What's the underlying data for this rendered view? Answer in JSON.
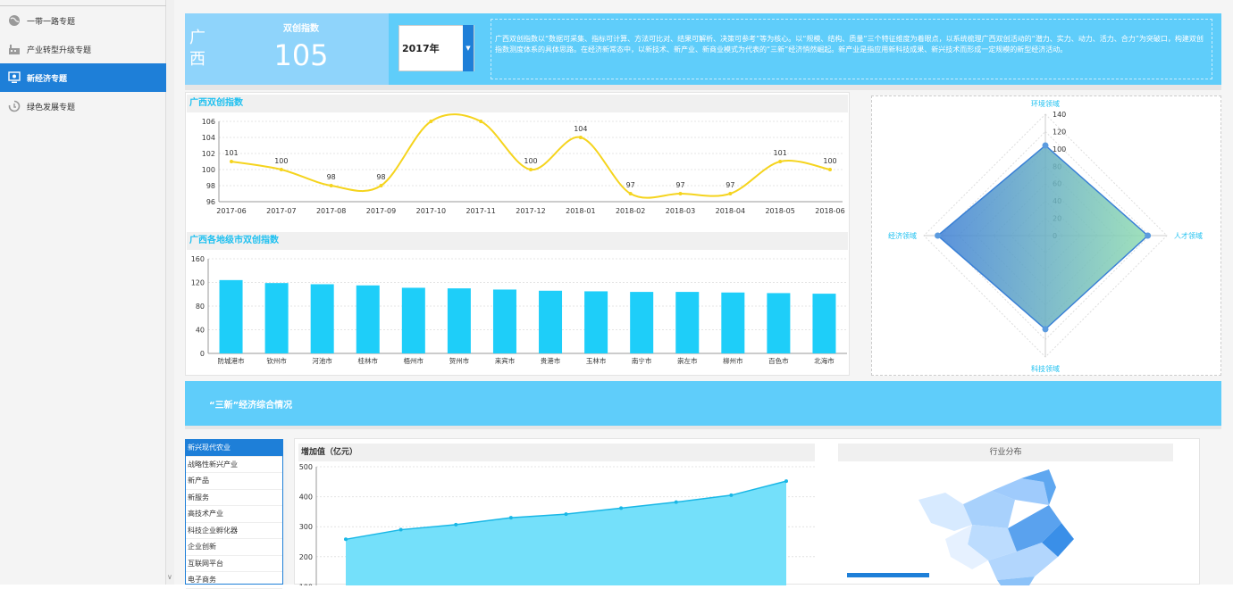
{
  "sidebar": {
    "items": [
      {
        "label": "一带一路专题",
        "icon": "globe-icon"
      },
      {
        "label": "产业转型升级专题",
        "icon": "factory-icon"
      },
      {
        "label": "新经济专题",
        "icon": "monitor-icon",
        "active": true
      },
      {
        "label": "绿色发展专题",
        "icon": "cycle-icon"
      }
    ]
  },
  "header": {
    "region": "广西",
    "index_title": "双创指数",
    "index_value": "105",
    "year": "2017年",
    "description": "广西双创指数以“数据可采集、指标可计算、方法可比对、结果可解析、决策可参考”等为核心。以“规模、结构、质量”三个特征维度为着眼点，以系统梳理广西双创活动的“潜力、实力、动力、活力、合力”为突破口，构建双创指数测度体系的具体思路。在经济新常态中，以新技术、新产业、新商业模式为代表的“三新”经济悄然崛起。新产业是指应用新科技成果、新兴技术而形成一定规模的新型经济活动。"
  },
  "line_panel": {
    "title": "广西双创指数"
  },
  "bar_panel": {
    "title": "广西各地级市双创指数"
  },
  "sanxin": {
    "title": "“三新”经济综合情况"
  },
  "categories": [
    "新兴现代农业",
    "战略性新兴产业",
    "新产品",
    "新服务",
    "高技术产业",
    "科技企业孵化器",
    "企业创新",
    "互联网平台",
    "电子商务"
  ],
  "area_panel": {
    "title": "增加值（亿元）"
  },
  "map_panel": {
    "title": "行业分布"
  },
  "colors": {
    "accent": "#1e7fd8",
    "header": "#5fcdfa",
    "line": "#f5d41e",
    "bar": "#1ecef9"
  },
  "chart_data": [
    {
      "type": "line",
      "title": "广西双创指数",
      "x": [
        "2017-06",
        "2017-07",
        "2017-08",
        "2017-09",
        "2017-10",
        "2017-11",
        "2017-12",
        "2018-01",
        "2018-02",
        "2018-03",
        "2018-04",
        "2018-05",
        "2018-06"
      ],
      "values": [
        101,
        100,
        98,
        98,
        106,
        106,
        100,
        104,
        97,
        97,
        97,
        101,
        100
      ],
      "data_labels": [
        "101",
        "100",
        "98",
        "98",
        "",
        "",
        "100",
        "104",
        "97",
        "97",
        "97",
        "101",
        "100"
      ],
      "ylim": [
        96,
        106
      ],
      "yticks": [
        96,
        98,
        100,
        102,
        104,
        106
      ]
    },
    {
      "type": "bar",
      "title": "广西各地级市双创指数",
      "categories": [
        "防城港市",
        "钦州市",
        "河池市",
        "桂林市",
        "梧州市",
        "贺州市",
        "来宾市",
        "贵港市",
        "玉林市",
        "南宁市",
        "崇左市",
        "柳州市",
        "百色市",
        "北海市"
      ],
      "values": [
        124,
        119,
        117,
        115,
        111,
        110,
        108,
        106,
        105,
        104,
        104,
        103,
        102,
        101
      ],
      "ylim": [
        0,
        160
      ],
      "yticks": [
        0,
        40,
        80,
        120,
        160
      ]
    },
    {
      "type": "radar",
      "indicators": [
        "环境领域",
        "人才领域",
        "科技领域",
        "经济领域"
      ],
      "values": [
        104,
        118,
        108,
        124
      ],
      "max": 140,
      "ticks": [
        0,
        20,
        40,
        60,
        80,
        100,
        120,
        140
      ]
    },
    {
      "type": "area",
      "title": "增加值（亿元）",
      "values": [
        258,
        290,
        307,
        330,
        342,
        362,
        382,
        405,
        452
      ],
      "ylim": [
        0,
        500
      ],
      "yticks": [
        100,
        200,
        300,
        400,
        500
      ]
    }
  ]
}
